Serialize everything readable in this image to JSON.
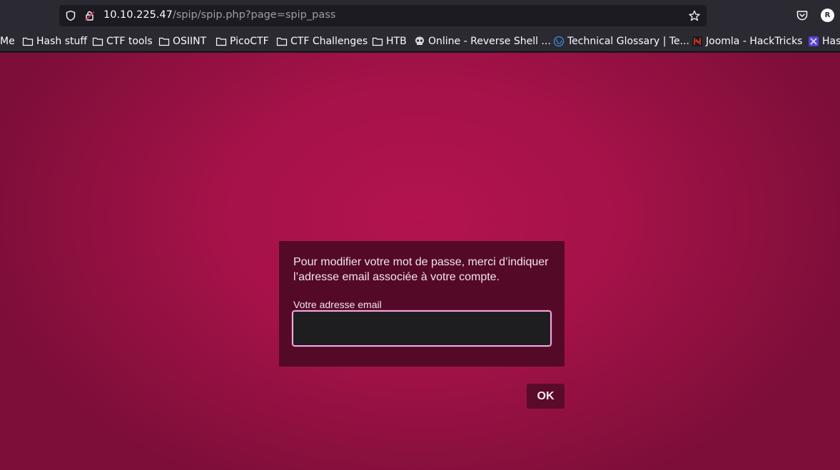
{
  "browser": {
    "url_host": "10.10.225.47",
    "url_path": "/spip/spip.php?page=spip_pass",
    "profile_initial": "R"
  },
  "bookmarks": [
    {
      "label": "Me",
      "icon": "none"
    },
    {
      "label": "Hash stuff",
      "icon": "folder-icon"
    },
    {
      "label": "CTF tools",
      "icon": "folder-icon"
    },
    {
      "label": "OSIINT",
      "icon": "folder-icon"
    },
    {
      "label": "PicoCTF",
      "icon": "folder-icon"
    },
    {
      "label": "CTF Challenges",
      "icon": "folder-icon"
    },
    {
      "label": "HTB",
      "icon": "folder-icon"
    },
    {
      "label": "Online - Reverse Shell ...",
      "icon": "skull-icon"
    },
    {
      "label": "Technical Glossary | Te...",
      "icon": "globe-icon"
    },
    {
      "label": "Joomla - HackTricks",
      "icon": "hacktricks-icon"
    },
    {
      "label": "Has",
      "icon": "site-icon"
    }
  ],
  "form": {
    "intro": "Pour modifier votre mot de passe, merci d’indiquer l’adresse email associée à votre compte.",
    "email_label": "Votre adresse email",
    "email_value": "",
    "submit_label": "OK"
  },
  "colors": {
    "page_bg": "#a51249",
    "card_bg": "#540a27",
    "input_focus_border": "#f6a7da",
    "button_bg": "#5a0b2a"
  }
}
